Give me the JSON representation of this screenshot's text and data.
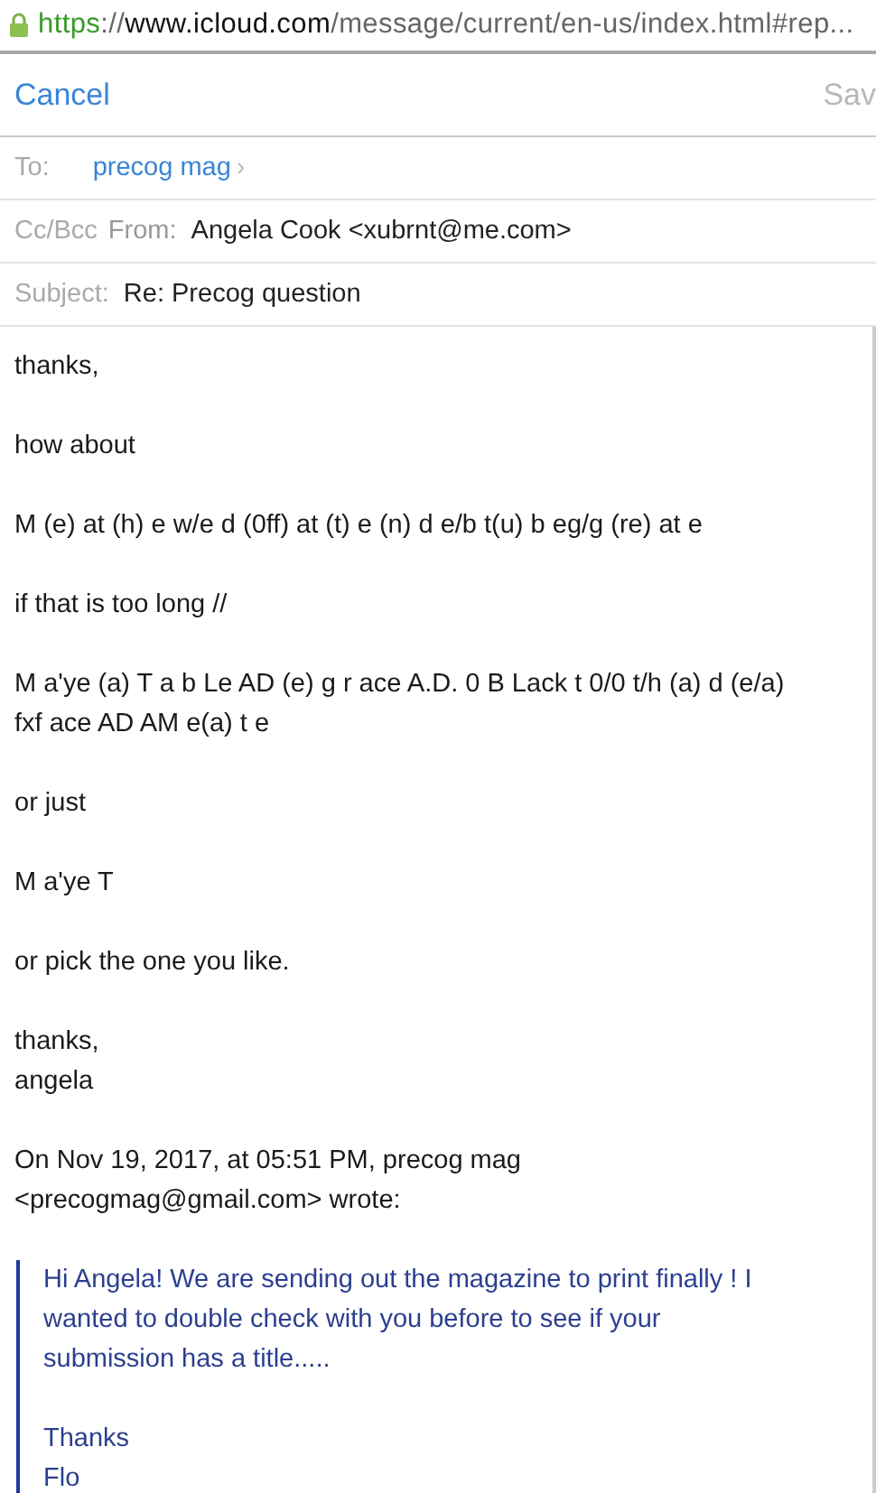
{
  "address_bar": {
    "secure": true,
    "scheme": "https",
    "separator": "://",
    "host": "www.icloud.com",
    "path": "/message/current/en-us/index.html#rep..."
  },
  "toolbar": {
    "cancel": "Cancel",
    "save": "Sav"
  },
  "fields": [
    {
      "kind": "recipient",
      "label": "To:",
      "value": "precog mag",
      "chevron": "›"
    },
    {
      "kind": "from",
      "label": "Cc/Bcc",
      "sublabel": "From:",
      "value": "Angela Cook <xubrnt@me.com>"
    },
    {
      "kind": "text",
      "label": "Subject:",
      "value": "Re: Precog question"
    }
  ],
  "body": [
    [
      "thanks,"
    ],
    [
      "how about"
    ],
    [
      "M (e) at (h) e w/e d (0ff) at (t) e (n) d e/b t(u) b eg/g (re) at e"
    ],
    [
      "if that is too long //"
    ],
    [
      "M a'ye (a) T a b Le AD (e) g r ace A.D. 0 B Lack t 0/0 t/h (a) d (e/a)",
      "fxf ace AD AM e(a) t e"
    ],
    [
      "or just"
    ],
    [
      "M a'ye T"
    ],
    [
      "or pick the one you like."
    ],
    [
      "thanks,",
      "angela"
    ],
    [
      "On Nov 19, 2017, at 05:51 PM, precog mag",
      "<precogmag@gmail.com> wrote:"
    ]
  ],
  "quote": [
    [
      "Hi Angela! We are sending out the magazine to print finally ! I",
      "wanted to double check with you before to see if your",
      "submission has a title....."
    ],
    [
      "Thanks",
      "Flo"
    ]
  ]
}
